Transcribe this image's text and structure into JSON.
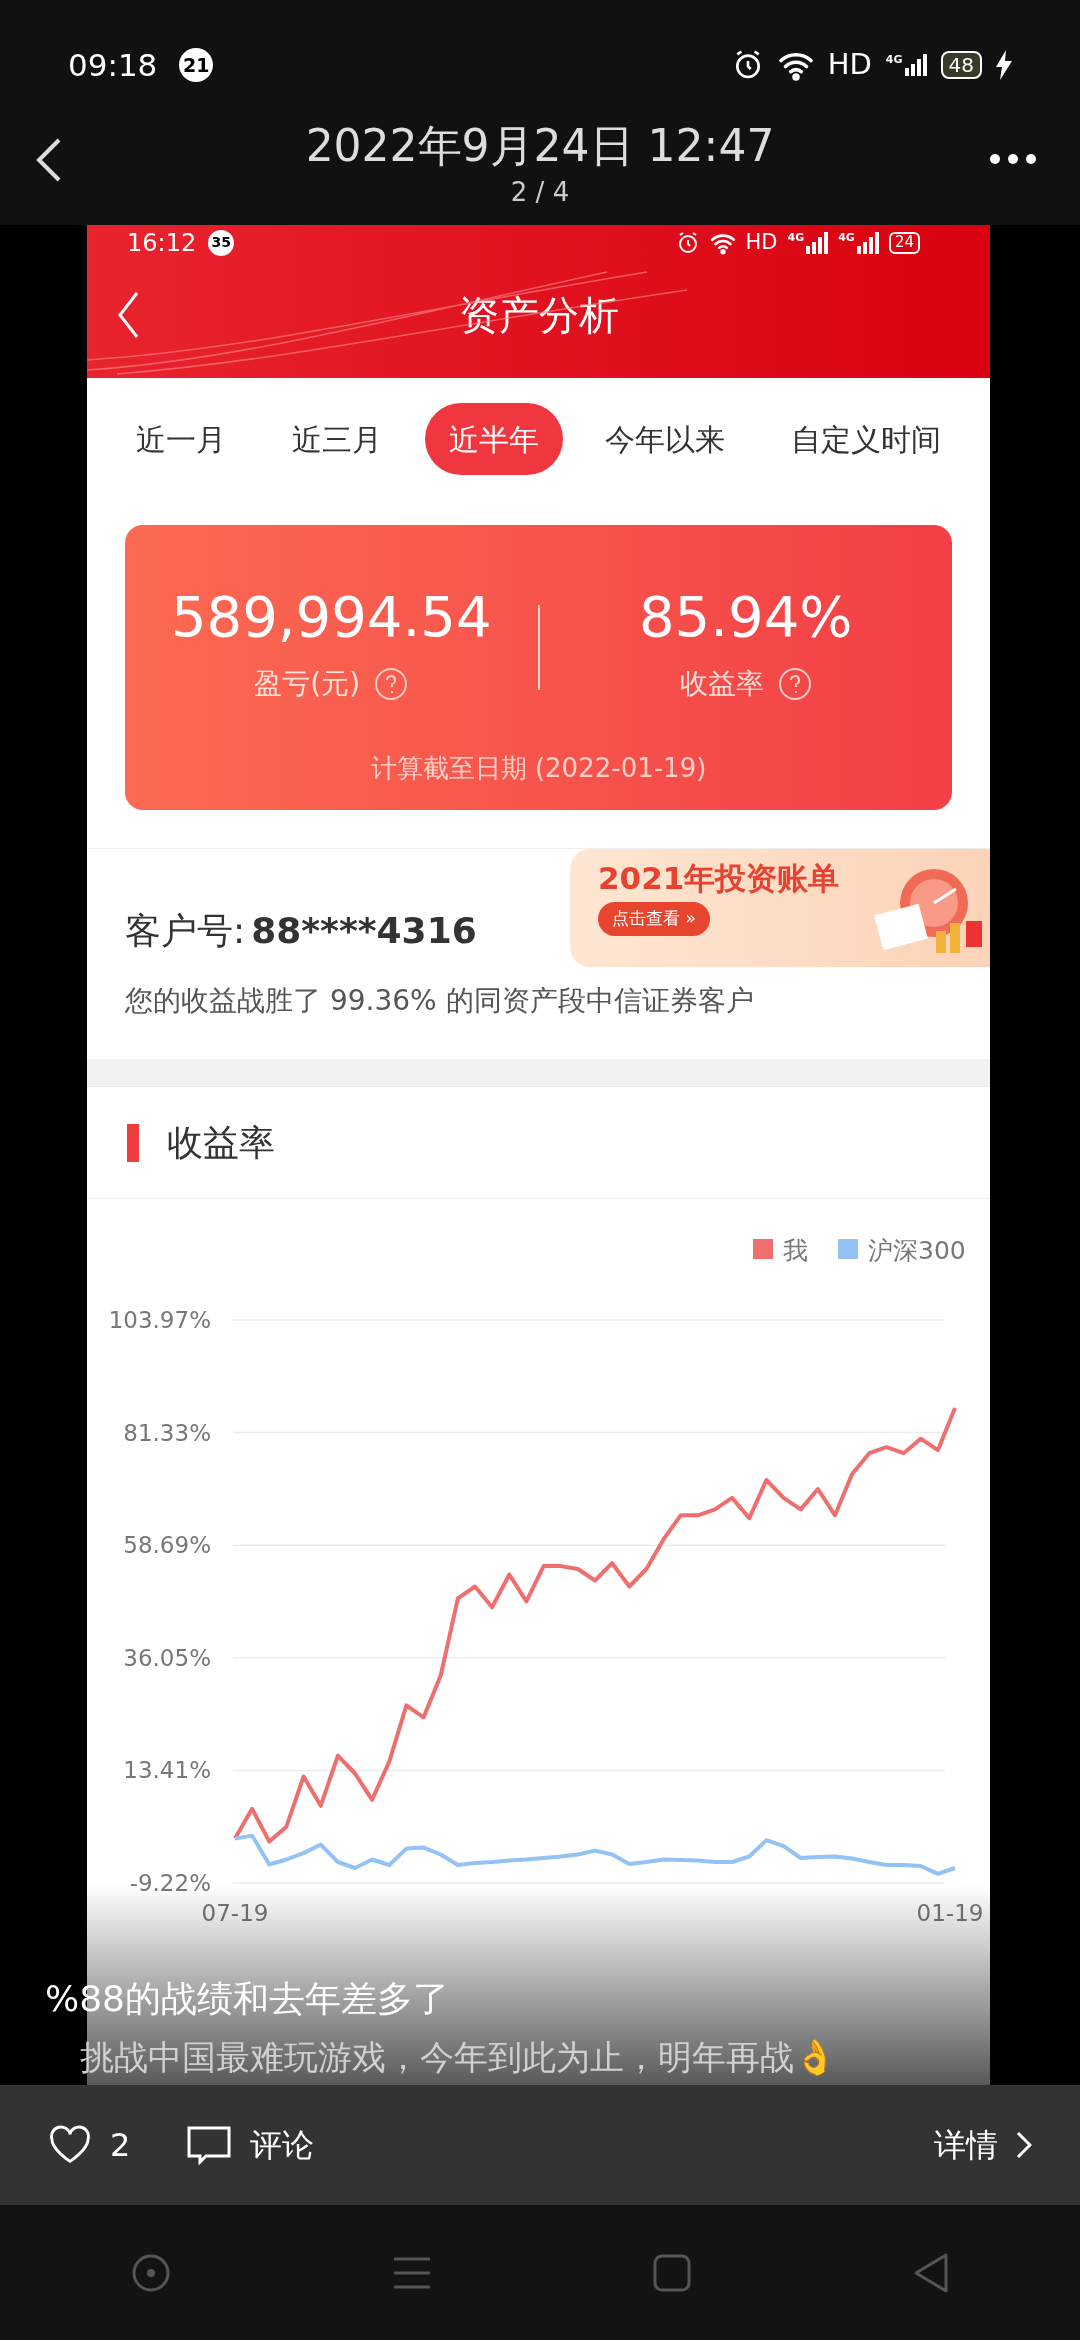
{
  "status_bar": {
    "time": "09:18",
    "badge": "21",
    "network": "HD",
    "signal": "4G",
    "battery": "48"
  },
  "viewer": {
    "title": "2022年9月24日 12:47",
    "counter": "2 / 4"
  },
  "screenshot": {
    "status_bar": {
      "time": "16:12",
      "badge": "35",
      "network": "HD",
      "signals": [
        "4G",
        "4G"
      ],
      "battery": "24"
    },
    "header": {
      "title": "资产分析"
    },
    "tabs": [
      {
        "label": "近一月",
        "selected": false
      },
      {
        "label": "近三月",
        "selected": false
      },
      {
        "label": "近半年",
        "selected": true
      },
      {
        "label": "今年以来",
        "selected": false
      },
      {
        "label": "自定义时间",
        "selected": false
      }
    ],
    "summary": {
      "profit": "589,994.54",
      "profit_label": "盈亏(元)",
      "rate": "85.94%",
      "rate_label": "收益率",
      "as_of": "计算截至日期 (2022-01-19)"
    },
    "customer": {
      "label": "客户号:",
      "number": "88****4316",
      "note": "您的收益战胜了 99.36% 的同资产段中信证券客户"
    },
    "banner": {
      "title": "2021年投资账单",
      "button": "点击查看 »"
    },
    "section": {
      "title": "收益率"
    },
    "chart_data": {
      "type": "line",
      "grid": true,
      "legend": "top-right",
      "categories": [
        "07-19",
        null,
        null,
        null,
        null,
        null,
        null,
        null,
        null,
        null,
        null,
        null,
        null,
        null,
        null,
        null,
        null,
        null,
        null,
        null,
        null,
        null,
        null,
        null,
        null,
        null,
        null,
        null,
        null,
        null,
        null,
        null,
        null,
        null,
        null,
        null,
        null,
        null,
        null,
        null,
        null,
        null,
        "01-19"
      ],
      "ylim": [
        -9.22,
        103.97
      ],
      "yticks": [
        {
          "value": -9.22,
          "label": "-9.22%"
        },
        {
          "value": 13.41,
          "label": "13.41%"
        },
        {
          "value": 36.05,
          "label": "36.05%"
        },
        {
          "value": 58.69,
          "label": "58.69%"
        },
        {
          "value": 81.33,
          "label": "81.33%"
        },
        {
          "value": 103.97,
          "label": "103.97%"
        }
      ],
      "series": [
        {
          "name": "我",
          "color": "#ef6e6e",
          "values": [
            -0.3,
            5.7,
            -0.9,
            2.1,
            12.2,
            6.3,
            16.4,
            12.8,
            7.5,
            15.2,
            26.5,
            24.1,
            32.5,
            48,
            50.4,
            46.2,
            52.8,
            47.4,
            54.5,
            54.5,
            53.9,
            51.6,
            55.1,
            50.4,
            53.9,
            59.9,
            64.7,
            64.7,
            65.9,
            68.2,
            64.1,
            71.8,
            68.2,
            65.9,
            70,
            64.7,
            73,
            77.2,
            78.4,
            77.2,
            80.1,
            77.8,
            86.3
          ]
        },
        {
          "name": "沪深300",
          "color": "#94c2f5",
          "values": [
            -0.3,
            0.3,
            -5.5,
            -4.5,
            -3.2,
            -1.5,
            -5,
            -6.2,
            -4.5,
            -5.6,
            -2.3,
            -2.1,
            -3.5,
            -5.6,
            -5.2,
            -5,
            -4.7,
            -4.5,
            -4.2,
            -3.9,
            -3.5,
            -2.7,
            -3.5,
            -5.4,
            -5,
            -4.5,
            -4.6,
            -4.7,
            -5,
            -5,
            -3.9,
            -0.6,
            -1.8,
            -4.2,
            -4,
            -3.9,
            -4.3,
            -5,
            -5.6,
            -5.6,
            -5.8,
            -7.4,
            -6.2
          ]
        }
      ]
    }
  },
  "captions": [
    "%88的战绩和去年差多了",
    "挑战中国最难玩游戏，今年到此为止，明年再战👌"
  ],
  "toolbar": {
    "likes": "2",
    "comment": "评论",
    "details": "详情"
  }
}
